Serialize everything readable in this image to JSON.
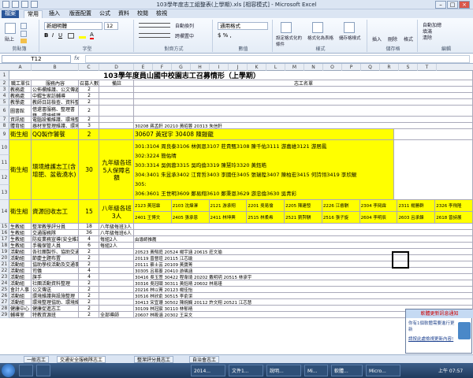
{
  "window": {
    "title": "103學年度志工組整表(上學期).xls [相容模式] - Microsoft Excel"
  },
  "ribbon_tabs": [
    "檔案",
    "常用",
    "插入",
    "版面配置",
    "公式",
    "資料",
    "校閱",
    "檢視"
  ],
  "ribbon": {
    "paste": "貼上",
    "clipboard": "剪貼簿",
    "font_name": "新細明體",
    "font_size": "12",
    "font_group": "字型",
    "align_group": "對齊方式",
    "wrap": "自動換列",
    "merge": "跨欄置中",
    "number_format": "通用格式",
    "number_group": "數值",
    "cond_format": "設定格式化的條件",
    "table_format": "格式化為表格",
    "cell_style": "儲存格樣式",
    "style_group": "樣式",
    "insert": "插入",
    "delete": "刪除",
    "format": "格式",
    "cells_group": "儲存格",
    "autosum": "自動加總",
    "fill": "填滿",
    "clear": "清除",
    "sort": "排序與篩選",
    "find": "尋找與選取",
    "edit_group": "編輯"
  },
  "formula": {
    "namebox": "T12",
    "fx": "fx",
    "value": ""
  },
  "columns": [
    "A",
    "B",
    "C",
    "D",
    "E",
    "F",
    "G",
    "H",
    "I",
    "J",
    "K",
    "L",
    "M",
    "N",
    "O",
    "P",
    "Q",
    "R",
    "S",
    "T"
  ],
  "sheet": {
    "title": "103學年度員山國中校園志工召募情形（上學期）",
    "headers": [
      "職工單位",
      "服務內容",
      "召募人數",
      "備註",
      "志工名單"
    ],
    "rows": [
      {
        "n": "3",
        "a": "教務處",
        "b": "公佈欄維護、公文傳遞",
        "c": "2",
        "d": "",
        "e": ""
      },
      {
        "n": "4",
        "a": "教務處",
        "b": "中輟生家訪輔導",
        "c": "2",
        "d": "",
        "e": ""
      },
      {
        "n": "5",
        "a": "教學處",
        "b": "教師日誌檢查、資料整理",
        "c": "2",
        "d": "",
        "e": ""
      },
      {
        "n": "6",
        "a": "圖書館",
        "b": "借還書服務、整理書籍、環境維護",
        "c": "2",
        "d": "",
        "e": ""
      },
      {
        "n": "7",
        "a": "資訊組",
        "b": "電腦設備維護、環境整理",
        "c": "2",
        "d": "",
        "e": ""
      },
      {
        "n": "8",
        "a": "體育組",
        "b": "器材室整理維護、環境整理",
        "c": "3",
        "d": "",
        "e": "30208 蔣孟軒 20210 黃昭蓉 20313 朱信軒"
      }
    ],
    "row9": {
      "a": "衛生組",
      "b": "QQ製作饕餮",
      "c": "2",
      "e": "30607 黃冠宇 30408 陳鎧龍"
    },
    "row10": {
      "a": "衛生組",
      "b": "環境維護志工(含增肥、盆栽澆水)",
      "c": "30",
      "d": "九年級各班5人保障名額",
      "lines": [
        "301:3104 周良泰3106 林佩恩3107 莊貴甄3108 陳千佑3111 游嘉維3121 游居鳳",
        "302:3224 簡佑晴",
        "303:3314 吳佩蓉3315 吳昀倫3319 陳慧玲3320 黃鈺皓",
        "304:3401 朱昱承3402 江育哲3403 李國任3405 張瑞陞3407 陳柏宏3415 何詩翎3419 李欣靚",
        "305:",
        "306:3601 王世明3609 鄭易翔3610 鄭秉恩3629 游忠倫3630 吳青彩"
      ]
    },
    "row14": {
      "a": "衛生組",
      "b": "資源回收志工",
      "c": "15",
      "d": "八年級各班3人",
      "top": [
        "2123 黃冠霖",
        "2103 沈煒澤",
        "2121 游承翔",
        "2201 吳易倫",
        "2205 陳建發",
        "2226 江睿騏",
        "2304 李岡霖",
        "2311 楊勝群",
        "2326 李飛隆"
      ],
      "bot": [
        "2401 王博文",
        "2405 張承恩",
        "2411 林坤興",
        "2515 林柔希",
        "2521 劉羿騏",
        "2516 張子旋",
        "2604 李明辰",
        "2603 呂承鍊",
        "2618 曾詩展"
      ]
    },
    "lower": [
      {
        "n": "15",
        "a": "生教組",
        "b": "整潔教學評分員",
        "c": "18",
        "d": "八年級每班3人"
      },
      {
        "n": "16",
        "a": "生教組",
        "b": "交通服務隊",
        "c": "36",
        "d": "八年級每班6人"
      },
      {
        "n": "17",
        "a": "生教組",
        "b": "防疫業務宣導(安全維護)",
        "c": "4",
        "d": "每組2人",
        "e": "由導師推薦"
      },
      {
        "n": "18",
        "a": "生教組",
        "b": "手機保管人員",
        "c": "6",
        "d": "每組2人",
        "e": ""
      },
      {
        "n": "19",
        "a": "活動組",
        "b": "各社團製作、協助交通事等",
        "c": "2",
        "e": "20523 黃郁庭 20524 楊宇涵 20615 莊文瑜"
      },
      {
        "n": "20",
        "a": "活動組",
        "b": "節慶主題布置",
        "c": "2",
        "e": "20119 曾晉瑄 20115 江芯瑜"
      },
      {
        "n": "21",
        "a": "活動組",
        "b": "協助學校活動及交通事項",
        "c": "2",
        "e": "20111 蔡士芸 20109 黃寶菁"
      },
      {
        "n": "22",
        "a": "活動組",
        "b": "司儀",
        "c": "4",
        "e": "30305 呂易蓁 20410 游瑀涵"
      },
      {
        "n": "23",
        "a": "活動組",
        "b": "旗手",
        "c": "4",
        "e": "30416 吳玉萱 30422 程韋琦 20202 戴明玥 20515 林承宇"
      },
      {
        "n": "24",
        "a": "活動組",
        "b": "社團活動資料整理",
        "c": "2",
        "e": "30316 吳冠頤 30311 黃鈺晴 20602 林易瑾"
      },
      {
        "n": "25",
        "a": "會計人事",
        "b": "公文傳送",
        "c": "2",
        "e": "20216 林以菁 20123 楊佳怡"
      },
      {
        "n": "26",
        "a": "活動組",
        "b": "環境維護與設施整理",
        "c": "2",
        "e": "30516 林欣俞 30515 李俞潔"
      },
      {
        "n": "27",
        "a": "活動組",
        "b": "環境整理協助、環境維護",
        "c": "2",
        "e": "30413 宋宜珊 30502 陳婉嫻 20112 許文翔 20521 江芯慧"
      },
      {
        "n": "28",
        "a": "健康中心",
        "b": "健康促進志工",
        "c": "2",
        "e": "30109 林冠宸 30110 林郁晴"
      },
      {
        "n": "29",
        "a": "輔導室",
        "b": "特教資源班",
        "c": "2",
        "d": "全部導師",
        "e": "20607 林筱涵 20302 王采文"
      }
    ]
  },
  "sheet_tabs": [
    "一般志工",
    "交通安全服務隊志工",
    "整潔評分員志工",
    "自治會志工"
  ],
  "popup": {
    "title": "軟體更新訊息通知",
    "body": "你有1個軟體需要進行更新",
    "link": "請按此處檢視更新內容!"
  },
  "taskbar": {
    "items": [
      "",
      "",
      "2014...",
      "文件1...",
      "說明...",
      "Mi...",
      "軟體...",
      "Micro..."
    ],
    "clock": "上午 07:57"
  }
}
